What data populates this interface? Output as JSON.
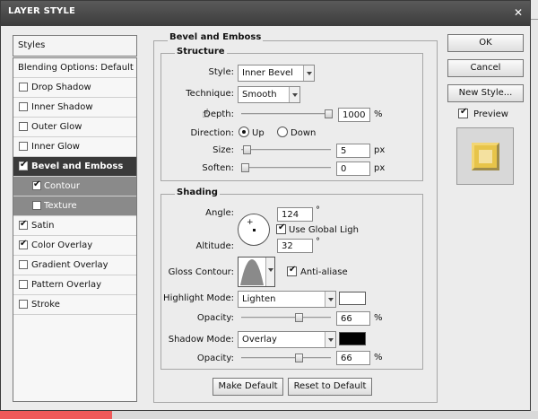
{
  "dialog": {
    "title": "LAYER STYLE"
  },
  "sidebar": {
    "header": "Styles",
    "items": [
      {
        "label": "Blending Options: Default",
        "checkbox": false
      },
      {
        "label": "Drop Shadow",
        "checkbox": true,
        "checked": false
      },
      {
        "label": "Inner Shadow",
        "checkbox": true,
        "checked": false
      },
      {
        "label": "Outer Glow",
        "checkbox": true,
        "checked": false
      },
      {
        "label": "Inner Glow",
        "checkbox": true,
        "checked": false
      },
      {
        "label": "Bevel and Emboss",
        "checkbox": true,
        "checked": true,
        "selected": true
      },
      {
        "label": "Contour",
        "checkbox": true,
        "checked": true,
        "sub": true
      },
      {
        "label": "Texture",
        "checkbox": true,
        "checked": false,
        "sub": true
      },
      {
        "label": "Satin",
        "checkbox": true,
        "checked": true
      },
      {
        "label": "Color Overlay",
        "checkbox": true,
        "checked": true
      },
      {
        "label": "Gradient Overlay",
        "checkbox": true,
        "checked": false
      },
      {
        "label": "Pattern Overlay",
        "checkbox": true,
        "checked": false
      },
      {
        "label": "Stroke",
        "checkbox": true,
        "checked": false
      }
    ]
  },
  "bevel": {
    "title": "Bevel and Emboss",
    "structure": {
      "title": "Structure",
      "style_label": "Style:",
      "style_value": "Inner Bevel",
      "technique_label": "Technique:",
      "technique_value": "Smooth",
      "depth_label": "Depth:",
      "depth_value": "1000",
      "depth_unit": "%",
      "depth_slider_fraction": 1.0,
      "direction_label": "Direction:",
      "direction_up": "Up",
      "direction_down": "Down",
      "direction_selected": "Up",
      "size_label": "Size:",
      "size_value": "5",
      "size_unit": "px",
      "size_slider_fraction": 0.02,
      "soften_label": "Soften:",
      "soften_value": "0",
      "soften_unit": "px",
      "soften_slider_fraction": 0.0
    },
    "shading": {
      "title": "Shading",
      "angle_label": "Angle:",
      "angle_value": "124",
      "angle_unit": "°",
      "use_global_light_label": "Use Global Ligh",
      "use_global_light_checked": true,
      "altitude_label": "Altitude:",
      "altitude_value": "32",
      "altitude_unit": "°",
      "gloss_contour_label": "Gloss Contour:",
      "anti_aliased_label": "Anti-aliase",
      "anti_aliased_checked": true,
      "highlight_mode_label": "Highlight Mode:",
      "highlight_mode_value": "Lighten",
      "highlight_color": "#ffffff",
      "highlight_opacity_label": "Opacity:",
      "highlight_opacity_value": "66",
      "highlight_opacity_unit": "%",
      "highlight_opacity_fraction": 0.66,
      "shadow_mode_label": "Shadow Mode:",
      "shadow_mode_value": "Overlay",
      "shadow_color": "#000000",
      "shadow_opacity_label": "Opacity:",
      "shadow_opacity_value": "66",
      "shadow_opacity_unit": "%",
      "shadow_opacity_fraction": 0.66
    },
    "make_default_label": "Make Default",
    "reset_default_label": "Reset to Default"
  },
  "actions": {
    "ok_label": "OK",
    "cancel_label": "Cancel",
    "new_style_label": "New Style...",
    "preview_label": "Preview",
    "preview_checked": true
  },
  "colors": {
    "accent_selected": "#3a3a3a",
    "preview_gold": "#e7c44a"
  }
}
